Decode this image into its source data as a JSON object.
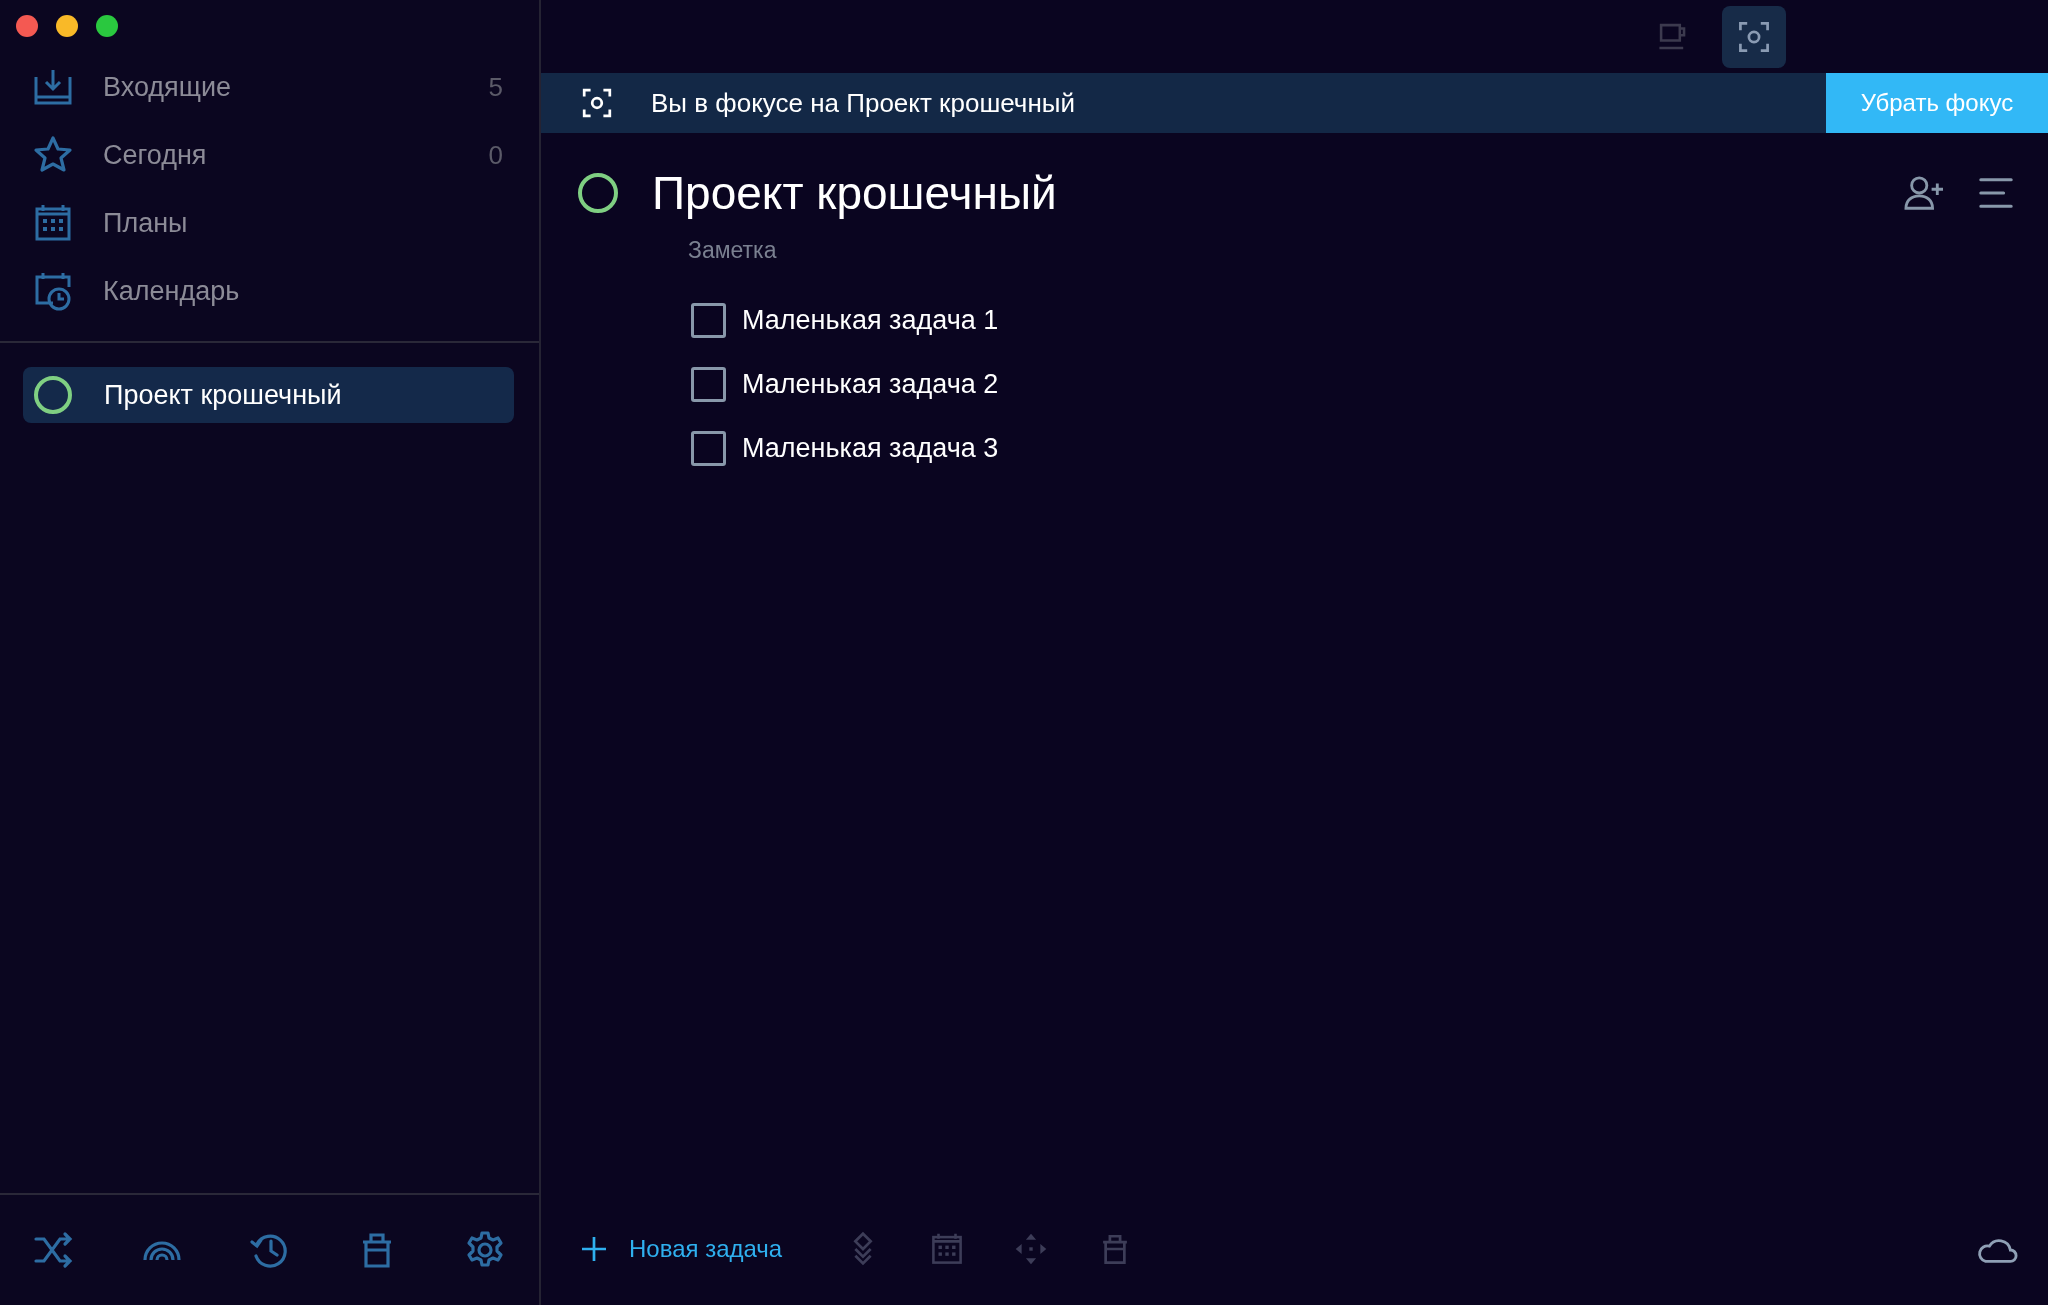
{
  "sidebar": {
    "nav": [
      {
        "label": "Входящие",
        "count": "5"
      },
      {
        "label": "Сегодня",
        "count": "0"
      },
      {
        "label": "Планы"
      },
      {
        "label": "Календарь"
      }
    ],
    "projects": [
      {
        "label": "Проект крошечный",
        "selected": true
      }
    ]
  },
  "toolbar": {
    "focus_selected": true
  },
  "focus_banner": {
    "text": "Вы в фокусе на Проект крошечный",
    "button": "Убрать фокус"
  },
  "project": {
    "title": "Проект крошечный",
    "note_placeholder": "Заметка",
    "tasks": [
      {
        "label": "Маленькая задача 1",
        "checked": false
      },
      {
        "label": "Маленькая задача 2",
        "checked": false
      },
      {
        "label": "Маленькая задача 3",
        "checked": false
      }
    ]
  },
  "bottom_bar": {
    "new_task": "Новая задача"
  }
}
